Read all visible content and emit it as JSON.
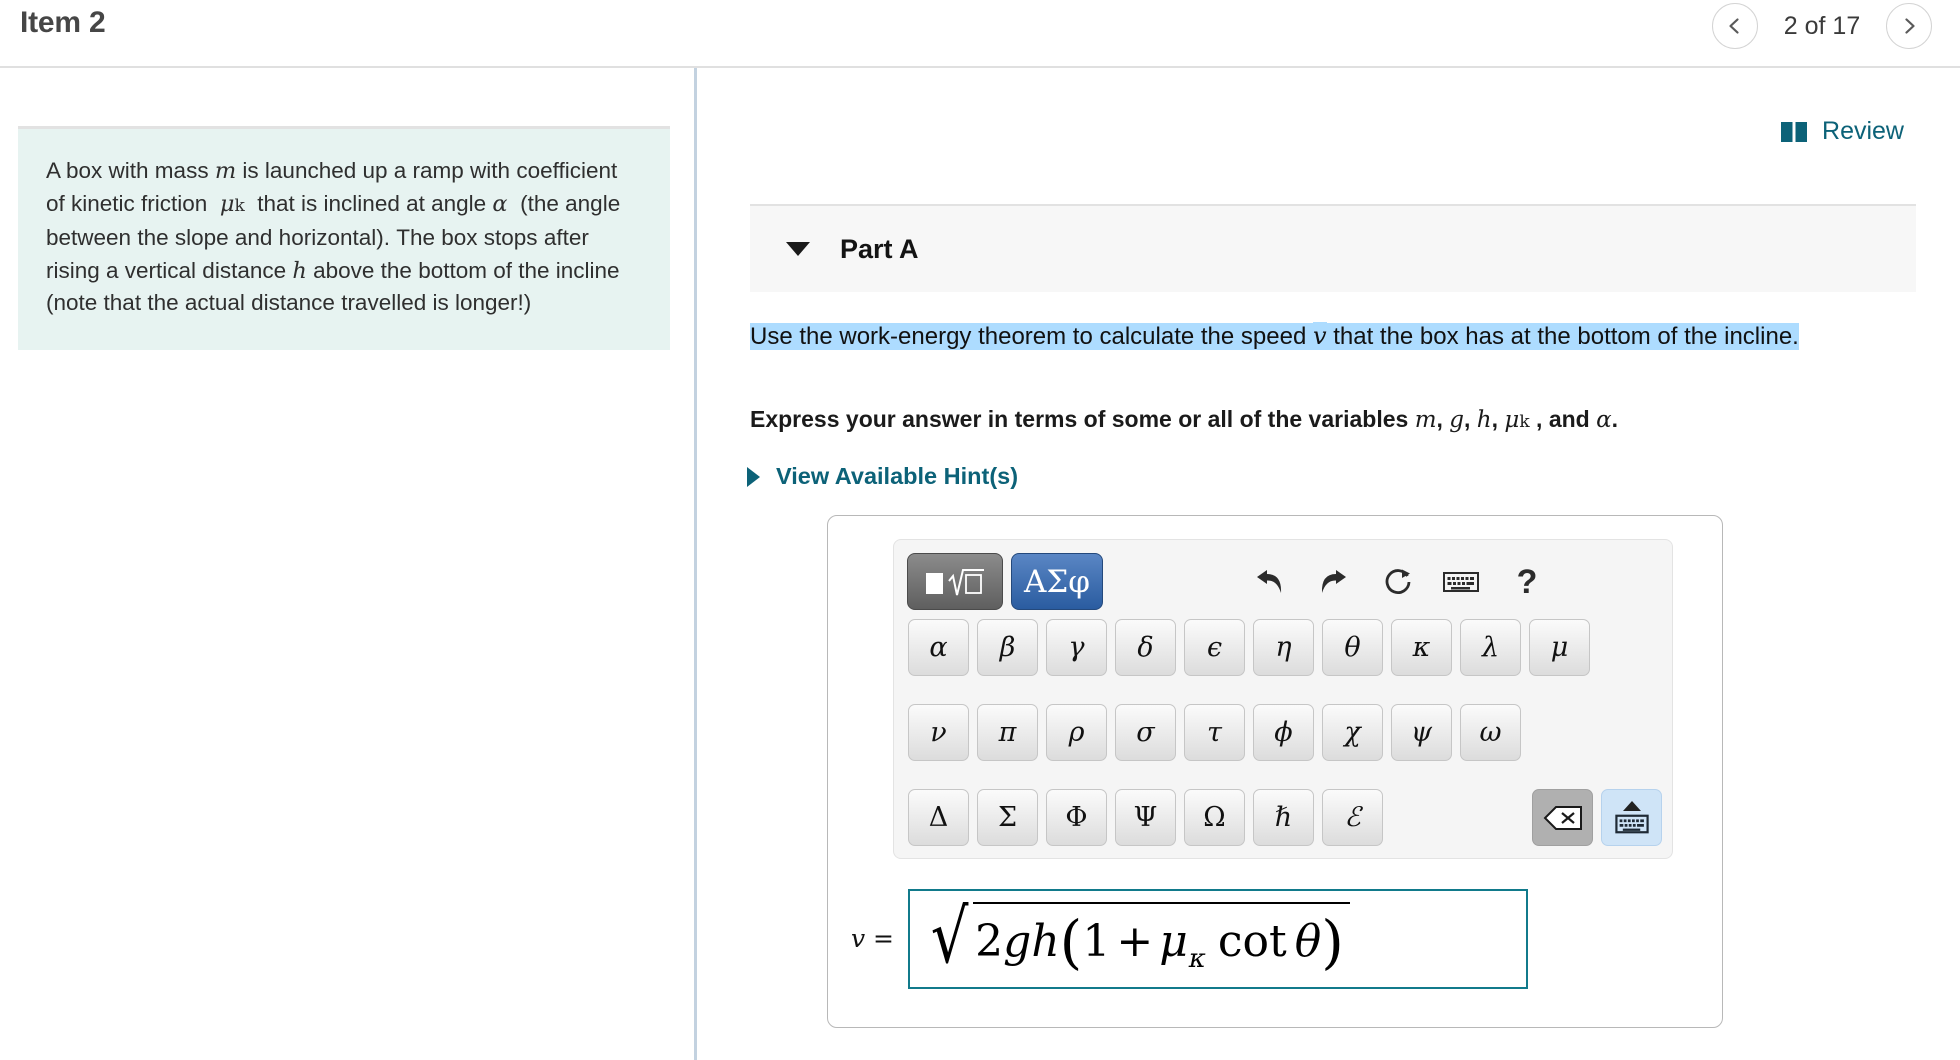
{
  "header": {
    "item_title": "Item 2",
    "pager_label": "2 of 17",
    "prev_icon": "chevron-left-icon",
    "next_icon": "chevron-right-icon"
  },
  "left_pane": {
    "problem_statement": "A box with mass m is launched up a ramp with coefficient of kinetic friction  μk  that is inclined at angle α  (the angle between the slope and horizontal). The box stops after rising a vertical distance h above the bottom of the incline (note that the actual distance travelled is longer!)",
    "background_color": "#e7f3f1"
  },
  "right_pane": {
    "review_label": "Review",
    "review_color": "#0c6278",
    "part": {
      "label": "Part A",
      "expanded": true,
      "caret_icon": "chevron-down-icon"
    },
    "question": {
      "highlighted_part_1": "Use the work-energy theorem to calculate the speed ",
      "variable_v": "v",
      "highlighted_part_2": " that the box has at the bottom of the incline.",
      "highlight_color": "#addcff"
    },
    "express_instruction": "Express your answer in terms of some or all of the variables m, g, h, μk , and α.",
    "hints_label": "View Available Hint(s)"
  },
  "math_palette": {
    "tabs": [
      {
        "name": "template-tab",
        "label": "",
        "icon": "square-root-template-icon",
        "active": false
      },
      {
        "name": "greek-tab",
        "label": "ΑΣφ",
        "active": true
      }
    ],
    "tools": [
      {
        "name": "undo-icon",
        "label": "undo"
      },
      {
        "name": "redo-icon",
        "label": "redo"
      },
      {
        "name": "reset-icon",
        "label": "reset"
      },
      {
        "name": "keyboard-icon",
        "label": "keyboard"
      },
      {
        "name": "help-icon",
        "label": "?"
      }
    ],
    "rows": [
      [
        "α",
        "β",
        "γ",
        "δ",
        "ϵ",
        "η",
        "θ",
        "κ",
        "λ",
        "μ"
      ],
      [
        "ν",
        "π",
        "ρ",
        "σ",
        "τ",
        "ϕ",
        "χ",
        "ψ",
        "ω"
      ],
      [
        "Δ",
        "Σ",
        "Φ",
        "Ψ",
        "Ω",
        "ℏ",
        "ℰ"
      ]
    ],
    "backspace_icon": "backspace-icon",
    "keyboard_toggle_icon": "keyboard-up-icon"
  },
  "answer": {
    "variable_label": "v =",
    "expression_plain": "sqrt(2gh(1 + μκ cot θ))",
    "coefficient": "2",
    "term_g": "g",
    "term_h": "h",
    "one": "1",
    "plus": "+",
    "mu": "μ",
    "mu_subscript": "κ",
    "cot": "cot",
    "theta": "θ",
    "border_color": "#117a8b"
  }
}
